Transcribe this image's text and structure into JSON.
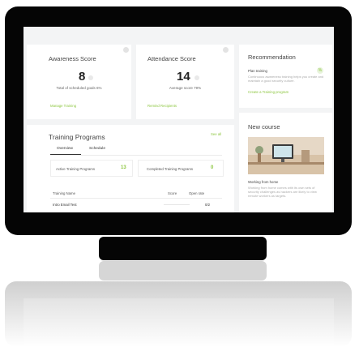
{
  "awareness": {
    "title": "Awareness Score",
    "score": "8",
    "caption": "Total of scheduled goals 6%",
    "link": "Manage Training"
  },
  "attendance": {
    "title": "Attendance Score",
    "score": "14",
    "caption": "Average score 79%",
    "link": "Remind Recipients"
  },
  "recommendation": {
    "title": "Recommendation",
    "item_title": "Plan training",
    "item_text": "Continuous awareness training helps you create and maintain a good security culture.",
    "link": "Create a Training program"
  },
  "training_programs": {
    "title": "Training Programs",
    "see_all": "See all",
    "tabs": [
      "Overview",
      "Schedule"
    ],
    "active_tab": "Overview",
    "active_label": "Active Training Programs",
    "active_count": "13",
    "completed_label": "Completed Training Programs",
    "completed_count": "0",
    "columns": [
      "Training Name",
      "Score",
      "Open rate"
    ],
    "rows": [
      {
        "name": "Intro Email Test",
        "score_fraction": 0.0,
        "open_rate": "0/2"
      }
    ]
  },
  "new_course": {
    "title": "New course",
    "course_title": "Working from home",
    "course_text": "Working from home comes with its own sets of security challenges as hackers are likely to view remote workers as targets."
  },
  "colors": {
    "accent": "#8cc63f",
    "frame": "#050505",
    "screen_bg": "#f3f4f5"
  }
}
